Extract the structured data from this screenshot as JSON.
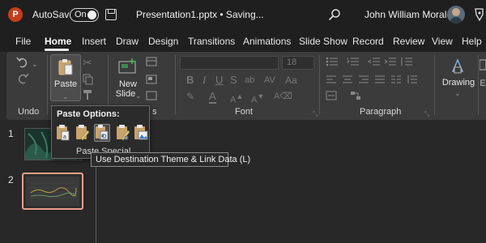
{
  "titlebar": {
    "app_logo": "P",
    "autosave_label": "AutoSave",
    "autosave_state": "On",
    "document_title": "Presentation1.pptx • Saving...",
    "user_name": "John William Morales"
  },
  "menu": {
    "tabs": [
      {
        "label": "File"
      },
      {
        "label": "Home",
        "active": true
      },
      {
        "label": "Insert"
      },
      {
        "label": "Draw"
      },
      {
        "label": "Design"
      },
      {
        "label": "Transitions"
      },
      {
        "label": "Animations"
      },
      {
        "label": "Slide Show"
      },
      {
        "label": "Record"
      },
      {
        "label": "Review"
      },
      {
        "label": "View"
      },
      {
        "label": "Help"
      }
    ]
  },
  "ribbon": {
    "undo_group_label": "Undo",
    "paste_label": "Paste",
    "new_slide_label": "New",
    "new_slide_label2": "Slide",
    "font_group_label": "Font",
    "font_size": "18",
    "paragraph_group_label": "Paragraph",
    "drawing_label": "Drawing",
    "partial_group_letter": "E",
    "slides_group_partial": "s"
  },
  "slides": {
    "items": [
      {
        "number": "1"
      },
      {
        "number": "2",
        "selected": true
      }
    ]
  },
  "paste_popup": {
    "title": "Paste Options:",
    "footer": "Paste Special..."
  },
  "tooltip": {
    "text": "Use Destination Theme & Link Data (L)"
  },
  "colors": {
    "accent_selected_slide": "#e8a08a",
    "app_logo": "#c43e1c",
    "chrome": "#1f1f1f",
    "ribbon": "#3b3b3b"
  }
}
